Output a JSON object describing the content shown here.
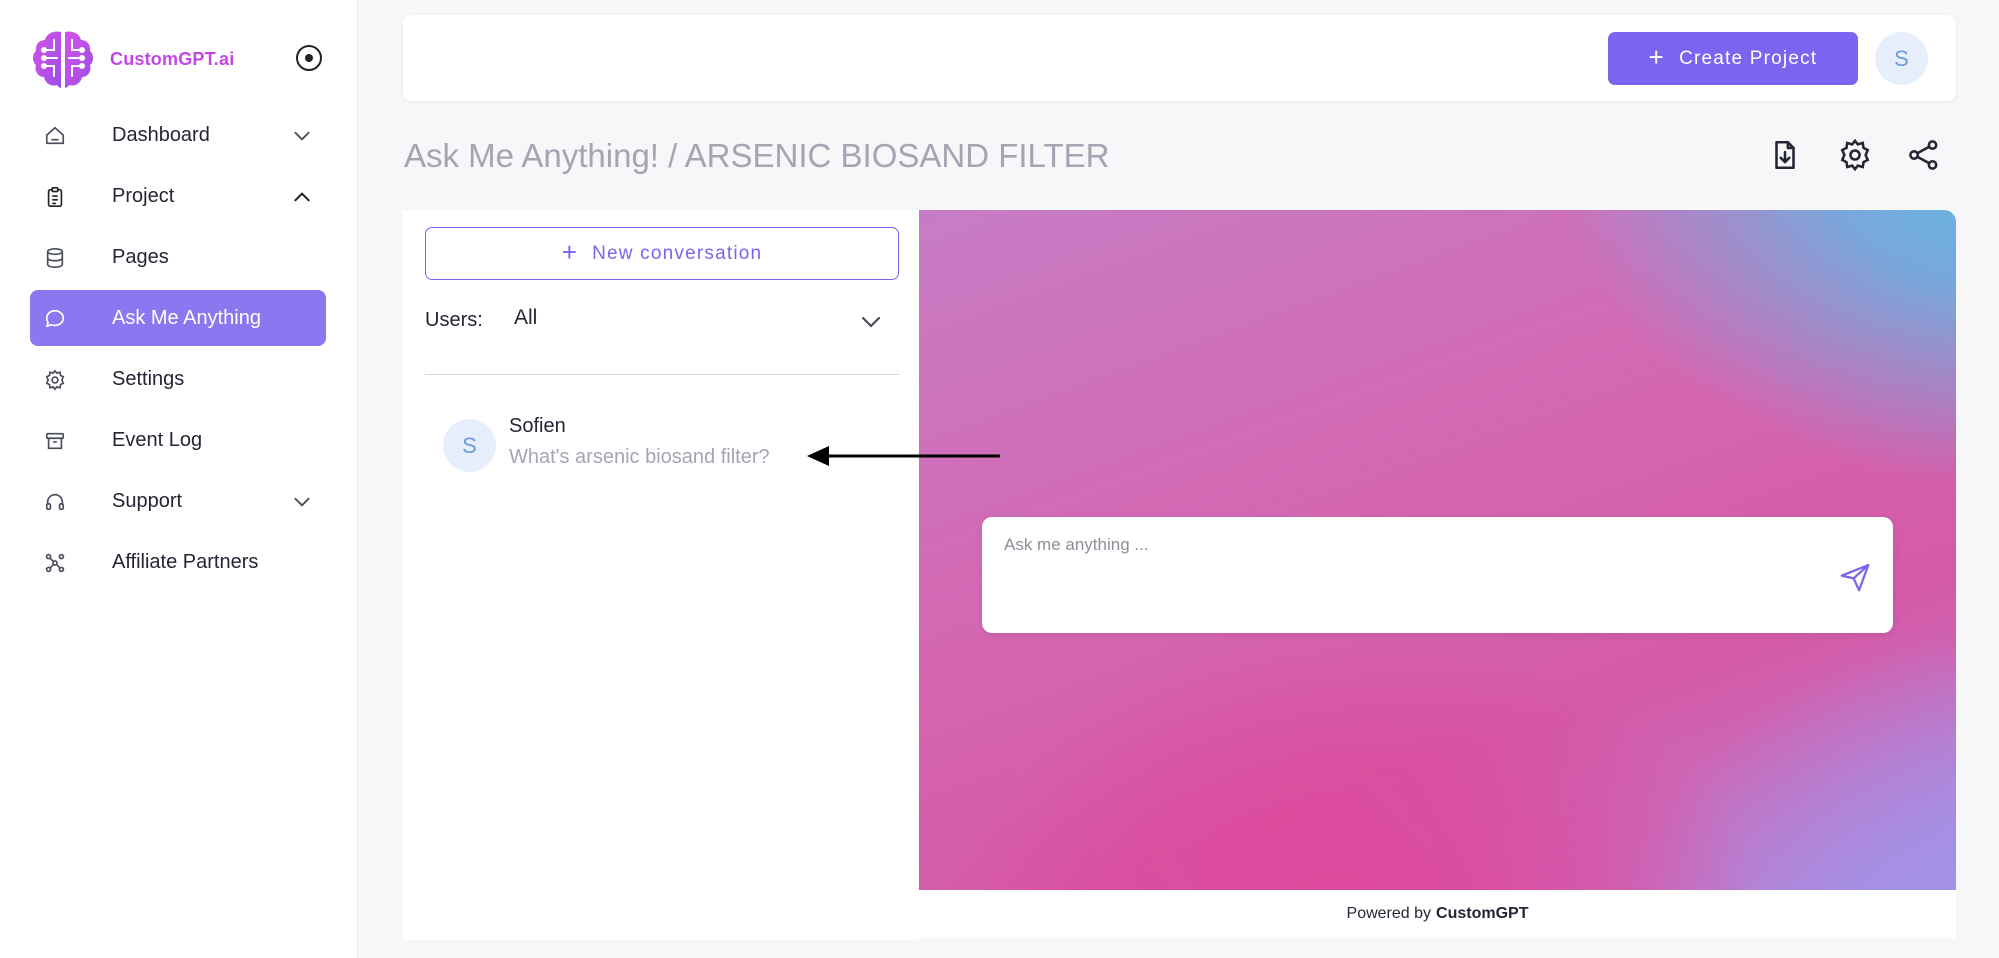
{
  "brand": {
    "name": "CustomGPT.ai",
    "color": "#c347e6"
  },
  "sidebar": {
    "items": [
      {
        "label": "Dashboard",
        "icon": "home-icon",
        "chevron": "down"
      },
      {
        "label": "Project",
        "icon": "clipboard-icon",
        "chevron": "up"
      },
      {
        "label": "Pages",
        "icon": "database-icon"
      },
      {
        "label": "Ask Me Anything",
        "icon": "chat-bubble-icon",
        "active": true
      },
      {
        "label": "Settings",
        "icon": "gear-icon"
      },
      {
        "label": "Event Log",
        "icon": "archive-icon"
      },
      {
        "label": "Support",
        "icon": "headset-icon",
        "chevron": "down"
      },
      {
        "label": "Affiliate Partners",
        "icon": "network-icon"
      }
    ]
  },
  "topbar": {
    "create_button": "Create Project",
    "avatar_initial": "S"
  },
  "page": {
    "title": "Ask Me Anything! / ARSENIC BIOSAND FILTER",
    "actions": [
      "download-file-icon",
      "gear-icon",
      "share-icon"
    ]
  },
  "conversations": {
    "new_button": "New conversation",
    "users_label": "Users:",
    "users_value": "All",
    "items": [
      {
        "initial": "S",
        "name": "Sofien",
        "message": "What's arsenic biosand filter?"
      }
    ]
  },
  "chat": {
    "placeholder": "Ask me anything ...",
    "powered_prefix": "Powered by",
    "powered_brand": "CustomGPT"
  },
  "colors": {
    "accent": "#7a64f0",
    "sidebar_active": "#8a78f1",
    "avatar_bg": "#e6effb",
    "avatar_text": "#6d9ad8"
  }
}
